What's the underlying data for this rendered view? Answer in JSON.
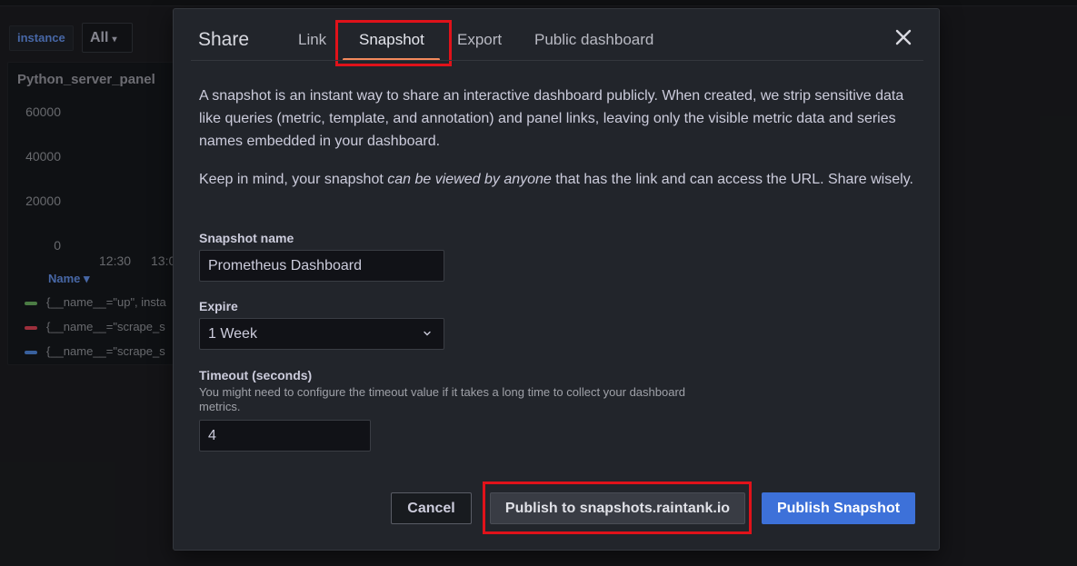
{
  "dashboard": {
    "variable_label": "instance",
    "variable_value": "All",
    "panel": {
      "title": "Python_server_panel",
      "y_ticks": [
        "60000",
        "40000",
        "20000",
        "0"
      ],
      "x_ticks": [
        "12:30",
        "13:0"
      ],
      "legend_header": "Name",
      "legend_items": [
        {
          "label": "{__name__=\"up\", insta",
          "color": "#73bf69"
        },
        {
          "label": "{__name__=\"scrape_s",
          "color": "#f2495c"
        },
        {
          "label": "{__name__=\"scrape_s",
          "color": "#5794f2"
        }
      ]
    }
  },
  "modal": {
    "title": "Share",
    "tabs": [
      {
        "label": "Link",
        "active": false
      },
      {
        "label": "Snapshot",
        "active": true
      },
      {
        "label": "Export",
        "active": false
      },
      {
        "label": "Public dashboard",
        "active": false
      }
    ],
    "description": "A snapshot is an instant way to share an interactive dashboard publicly. When created, we strip sensitive data like queries (metric, template, and annotation) and panel links, leaving only the visible metric data and series names embedded in your dashboard.",
    "warning_prefix": "Keep in mind, your snapshot ",
    "warning_emphasis": "can be viewed by anyone",
    "warning_suffix": " that has the link and can access the URL. Share wisely.",
    "snapshot_name": {
      "label": "Snapshot name",
      "value": "Prometheus Dashboard"
    },
    "expire": {
      "label": "Expire",
      "value": "1 Week"
    },
    "timeout": {
      "label": "Timeout (seconds)",
      "description": "You might need to configure the timeout value if it takes a long time to collect your dashboard metrics.",
      "value": "4"
    },
    "buttons": {
      "cancel": "Cancel",
      "publish_external": "Publish to snapshots.raintank.io",
      "publish": "Publish Snapshot"
    },
    "colors": {
      "accent": "#f2895c",
      "primary": "#3d71d9",
      "highlight": "#e0121a"
    }
  }
}
